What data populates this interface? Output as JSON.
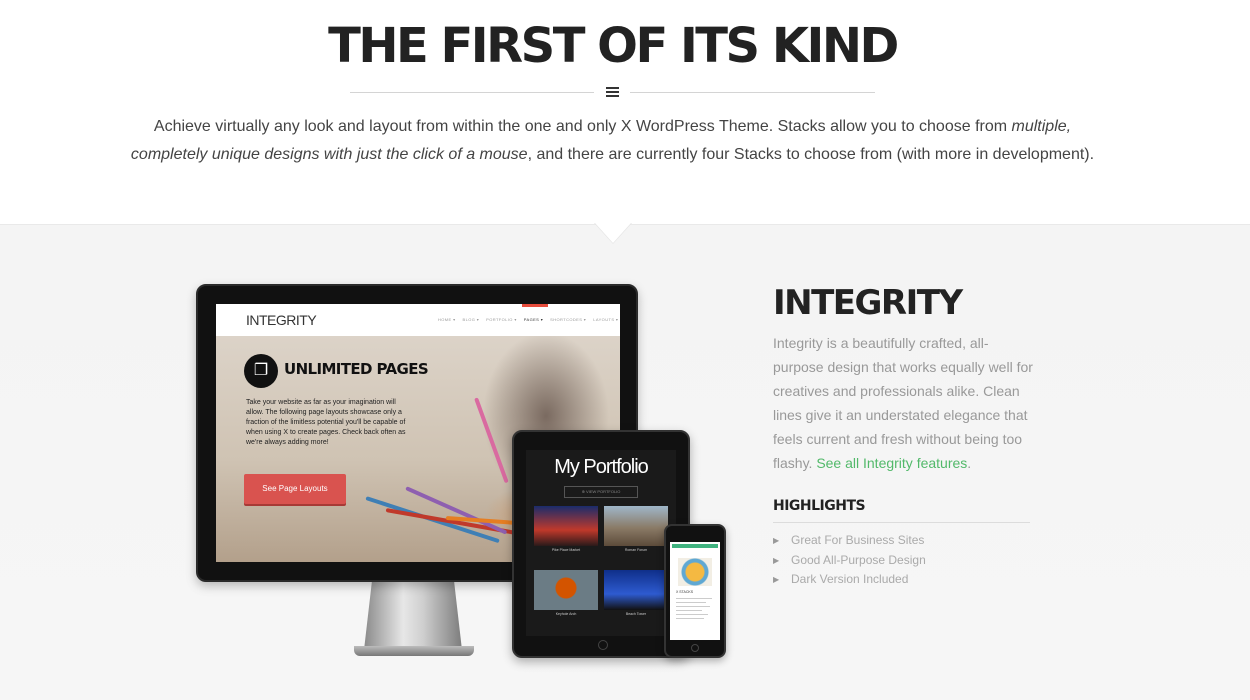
{
  "hero": {
    "title": "THE FIRST OF ITS KIND",
    "desc_part1": "Achieve virtually any look and layout from within the one and only X WordPress Theme. Stacks allow you to choose from ",
    "desc_italic": "multiple, completely unique designs with just the click of a mouse",
    "desc_part2": ", and there are currently four Stacks to choose from (with more in development)."
  },
  "preview": {
    "monitor": {
      "logo": "INTEGRITY",
      "menu": [
        "HOME ▾",
        "BLOG ▾",
        "PORTFOLIO ▾",
        "PAGES ▾",
        "SHORTCODES ▾",
        "LAYOUTS ▾"
      ],
      "heading": "UNLIMITED PAGES",
      "body": "Take your website as far as your imagination will allow. The following page layouts showcase only a fraction of the limitless potential you'll be capable of when using X to create pages. Check back often as we're always adding more!",
      "button": "See Page Layouts"
    },
    "tablet": {
      "title": "My Portfolio",
      "subtitle": "⊕ VIEW PORTFOLIO",
      "tiles": [
        "Pike Place Market",
        "Roman Forum",
        "Keyhole Arch",
        "Beach Tower"
      ]
    },
    "phone": {
      "label": "X STACKS"
    }
  },
  "stack": {
    "title": "INTEGRITY",
    "desc": "Integrity is a beautifully crafted, all-purpose design that works equally well for creatives and professionals alike. Clean lines give it an understated elegance that feels current and fresh without being too flashy. ",
    "link": "See all Integrity features",
    "link_after": ".",
    "highlights_title": "HIGHLIGHTS",
    "highlights": [
      "Great For Business Sites",
      "Good All-Purpose Design",
      "Dark Version Included"
    ]
  },
  "colors": {
    "accent_green": "#52b96a",
    "button_red": "#d9534f"
  },
  "icons": {
    "separator": "stack-icon",
    "pages": "pages-icon",
    "bullet": "caret-right-icon"
  }
}
